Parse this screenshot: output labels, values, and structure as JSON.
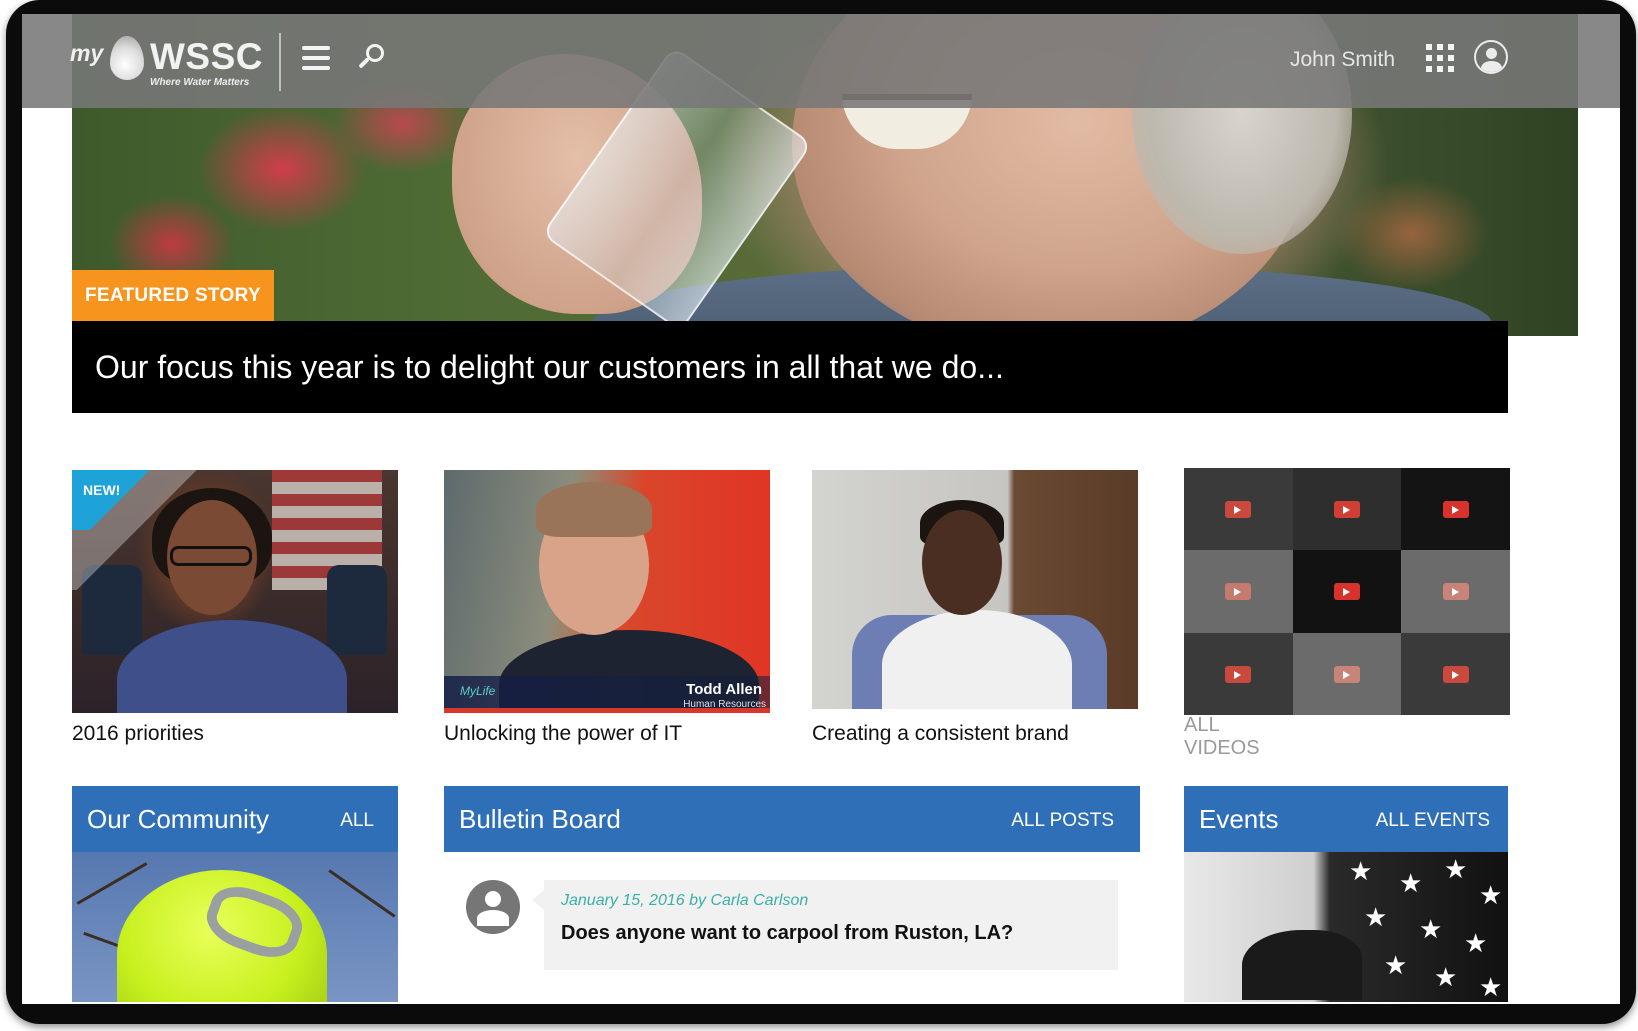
{
  "brand": {
    "prefix": "my",
    "name": "WSSC",
    "tagline": "Where Water Matters"
  },
  "header": {
    "user_name": "John Smith",
    "icons": [
      "menu-icon",
      "search-icon",
      "apps-grid-icon",
      "user-avatar-icon"
    ]
  },
  "featured": {
    "badge": "FEATURED STORY",
    "caption": "Our focus this year is to delight our customers in all that we do..."
  },
  "videos": {
    "items": [
      {
        "caption": "2016 priorities",
        "badge": "NEW!"
      },
      {
        "caption": "Unlocking the power of IT",
        "lower_third_name": "Todd Allen",
        "lower_third_title": "Human Resources",
        "lower_third_logo": "MyLife"
      },
      {
        "caption": "Creating a consistent brand"
      }
    ],
    "all_label": "ALL VIDEOS",
    "grid_colors": [
      "#3a3a3a",
      "#2e2e2e",
      "#141414",
      "#6b6b6b",
      "#121212",
      "#6b6b6b",
      "#3a3a3a",
      "#6b6b6b",
      "#3a3a3a"
    ],
    "cam_colors": [
      "#c94a3c",
      "#d13f34",
      "#d8322d",
      "#c47a6c",
      "#d8322d",
      "#c88478",
      "#c94a3c",
      "#c88478",
      "#c94a3c"
    ]
  },
  "community": {
    "title": "Our Community",
    "link": "ALL"
  },
  "bulletin": {
    "title": "Bulletin Board",
    "link": "ALL POSTS",
    "post": {
      "meta": "January 15, 2016 by Carla Carlson",
      "title": "Does anyone want to carpool from Ruston, LA?"
    }
  },
  "events": {
    "title": "Events",
    "link": "ALL EVENTS"
  },
  "colors": {
    "accent_orange": "#f7941d",
    "panel_blue": "#2f6fb8",
    "new_badge_blue": "#1ea3d8",
    "meta_teal": "#39b0a8"
  }
}
